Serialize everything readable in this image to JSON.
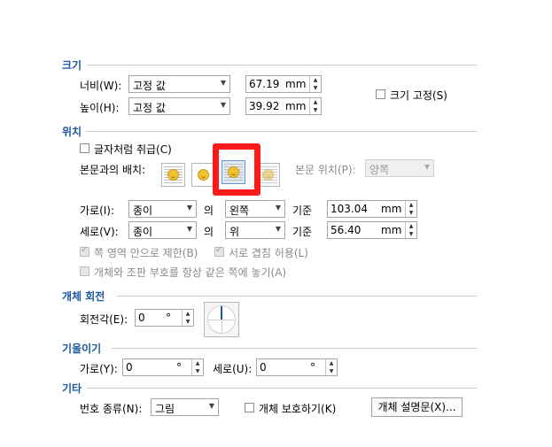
{
  "size": {
    "title": "크기",
    "width_label": "너비(W):",
    "width_mode": "고정 값",
    "width_value": "67.19",
    "width_unit": "mm",
    "height_label": "높이(H):",
    "height_mode": "고정 값",
    "height_value": "39.92",
    "height_unit": "mm",
    "fix_size_label": "크기 고정(S)"
  },
  "position": {
    "title": "위치",
    "treat_as_char_label": "글자처럼 취급(C)",
    "text_wrap_label": "본문과의 배치:",
    "body_position_label": "본문 위치(P):",
    "body_position_value": "양쪽",
    "horizontal_label": "가로(I):",
    "horizontal_ref": "종이",
    "horizontal_of": "의",
    "horizontal_align": "왼쪽",
    "horizontal_base": "기준",
    "horizontal_value": "103.04",
    "horizontal_unit": "mm",
    "vertical_label": "세로(V):",
    "vertical_ref": "종이",
    "vertical_of": "의",
    "vertical_align": "위",
    "vertical_base": "기준",
    "vertical_value": "56.40",
    "vertical_unit": "mm",
    "limit_in_page_label": "쪽 영역 안으로 제한(B)",
    "allow_overlap_label": "서로 겹침 허용(L)",
    "keep_same_page_label": "개체와 조판 부호를 항상 같은 쪽에 놓기(A)"
  },
  "rotation": {
    "title": "개체 회전",
    "angle_label": "회전각(E):",
    "angle_value": "0",
    "angle_unit": "°"
  },
  "skew": {
    "title": "기울이기",
    "horizontal_label": "가로(Y):",
    "horizontal_value": "0",
    "horizontal_unit": "°",
    "vertical_label": "세로(U):",
    "vertical_value": "0",
    "vertical_unit": "°"
  },
  "other": {
    "title": "기타",
    "number_type_label": "번호 종류(N):",
    "number_type_value": "그림",
    "protect_label": "개체 보호하기(K)",
    "description_button": "개체 설명문(X)..."
  },
  "colors": {
    "section_title": "#1f5aa0",
    "highlight_border": "#ff1a1a"
  }
}
